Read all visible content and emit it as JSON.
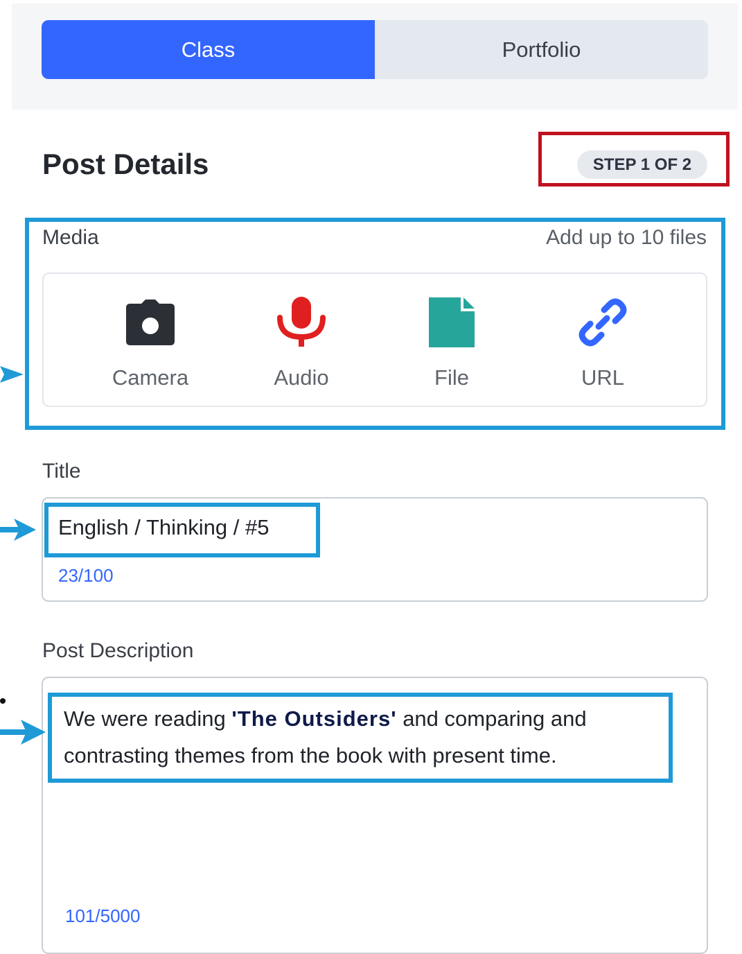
{
  "tabs": [
    {
      "label": "Class",
      "active": true
    },
    {
      "label": "Portfolio",
      "active": false
    }
  ],
  "header": {
    "title": "Post Details",
    "step": "STEP 1 OF 2"
  },
  "media": {
    "label": "Media",
    "hint": "Add up to 10 files",
    "options": [
      {
        "label": "Camera",
        "icon": "camera-icon"
      },
      {
        "label": "Audio",
        "icon": "microphone-icon"
      },
      {
        "label": "File",
        "icon": "file-icon"
      },
      {
        "label": "URL",
        "icon": "link-icon"
      }
    ]
  },
  "title_field": {
    "label": "Title",
    "value": "English / Thinking / #5",
    "counter": "23/100"
  },
  "description_field": {
    "label": "Post Description",
    "text_before": "We were reading ",
    "text_bold": "'The Outsiders'",
    "text_after": " and comparing and contrasting themes from the book with present time.",
    "counter": "101/5000"
  },
  "colors": {
    "accent": "#3366ff",
    "annotation_blue": "#1f9ad6",
    "annotation_red": "#c0111f",
    "audio_red": "#e02020",
    "file_green": "#26a69a",
    "camera_dark": "#2b2f36"
  }
}
